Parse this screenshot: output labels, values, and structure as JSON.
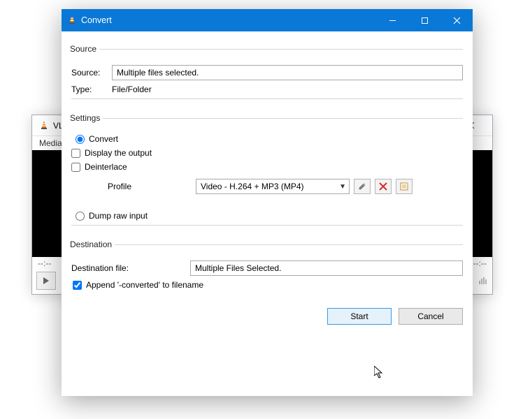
{
  "vlc_main": {
    "title": "VLC media player",
    "menu_first": "Media",
    "time_left": "--:--",
    "time_right": "--:--"
  },
  "dialog": {
    "title": "Convert",
    "groups": {
      "source": {
        "legend": "Source",
        "source_label": "Source:",
        "source_value": "Multiple files selected.",
        "type_label": "Type:",
        "type_value": "File/Folder"
      },
      "settings": {
        "legend": "Settings",
        "convert_label": "Convert",
        "display_label": "Display the output",
        "deinterlace_label": "Deinterlace",
        "profile_label": "Profile",
        "profile_value": "Video - H.264 + MP3 (MP4)",
        "dump_label": "Dump raw input"
      },
      "destination": {
        "legend": "Destination",
        "dest_label": "Destination file:",
        "dest_value": "Multiple Files Selected.",
        "append_label": "Append '-converted' to filename"
      }
    },
    "buttons": {
      "start": "Start",
      "cancel": "Cancel"
    }
  }
}
